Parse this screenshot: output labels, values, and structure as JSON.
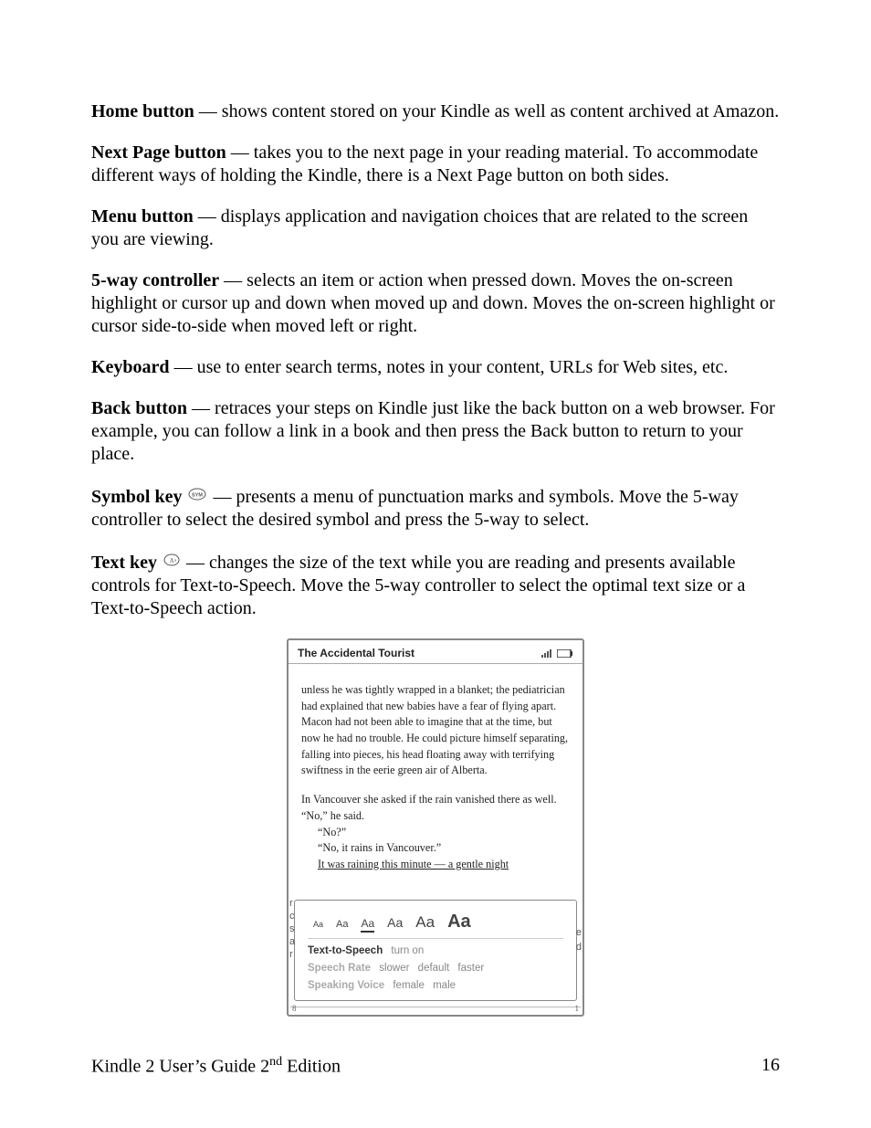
{
  "definitions": [
    {
      "term": "Home button",
      "text": " — shows content stored on your Kindle as well as content archived at Amazon."
    },
    {
      "term": "Next Page button",
      "text": " — takes you to the next page in your reading material. To accommodate different ways of holding the Kindle, there is a Next Page button on both sides."
    },
    {
      "term": "Menu button",
      "text": " — displays application and navigation choices that are related to the screen you are viewing."
    },
    {
      "term": "5-way controller",
      "text": " — selects an item or action when pressed down. Moves the on-screen highlight or cursor up and down when moved up and down. Moves the on-screen highlight or cursor side-to-side when moved left or right."
    },
    {
      "term": "Keyboard",
      "text": " — use to enter search terms, notes in your content, URLs for Web sites, etc."
    },
    {
      "term": "Back button",
      "text": " — retraces your steps on Kindle just like the back button on a web browser. For example, you can follow a link in a book and then press the Back button to return to your place."
    },
    {
      "term": "Symbol key",
      "icon": "sym",
      "text": " — presents a menu of punctuation marks and symbols. Move the 5-way controller to select the desired symbol and press the 5-way to select."
    },
    {
      "term": "Text key",
      "icon": "aa",
      "text": " — changes the size of the text while you are reading and presents available controls for Text-to-Speech. Move the 5-way controller to select the optimal text size or a Text-to-Speech action."
    }
  ],
  "kindle": {
    "title": "The Accidental Tourist",
    "para1": "unless he was tightly wrapped in a blanket; the pediatrician had explained that new babies have a fear of flying apart. Macon had not been able to imagine that at the time, but now he had no trouble. He could picture himself separating, falling into pieces, his head floating away with terrifying swiftness in the eerie green air of Alberta.",
    "para2_a": "In Vancouver she asked if the rain vanished there as well. “No,” he said.",
    "para2_b": "“No?”",
    "para2_c": "“No, it rains in Vancouver.”",
    "para2_d": "It was raining this minute — a gentle night",
    "popup": {
      "aa_label": "Aa",
      "tts": {
        "label": "Text-to-Speech",
        "value": "turn on"
      },
      "rate": {
        "label": "Speech Rate",
        "opt1": "slower",
        "opt2": "default",
        "opt3": "faster"
      },
      "voice": {
        "label": "Speaking Voice",
        "opt1": "female",
        "opt2": "male"
      }
    },
    "gutter_left": [
      "r",
      "c",
      "s",
      "a",
      "r"
    ],
    "gutter_right_top": "e",
    "gutter_right_bot": "d",
    "progress_left": "8",
    "progress_right": "1"
  },
  "footer": {
    "left_a": "Kindle 2 User’s Guide 2",
    "left_sup": "nd",
    "left_b": " Edition",
    "page": "16"
  }
}
